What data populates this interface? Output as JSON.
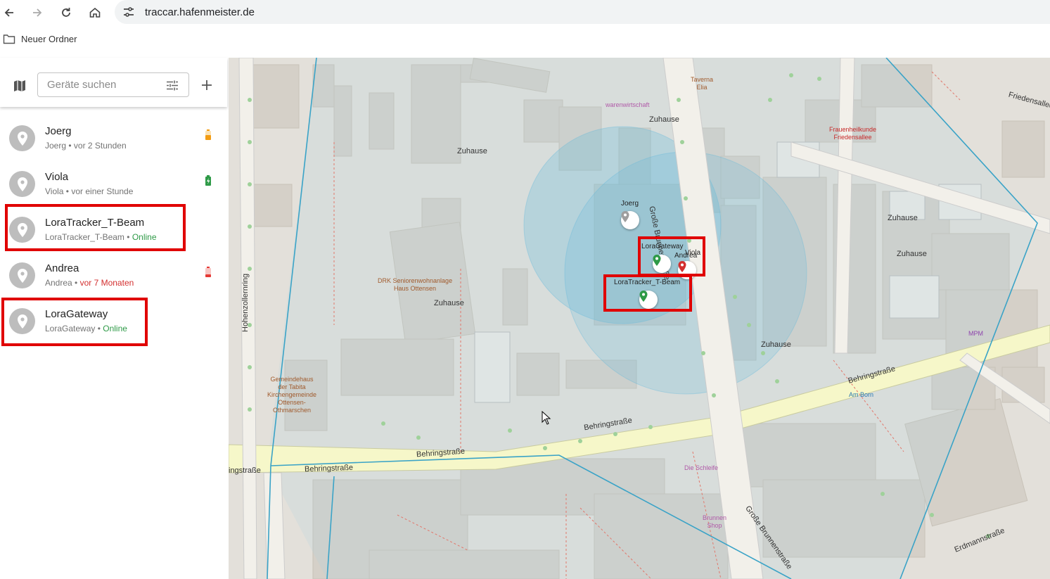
{
  "browser": {
    "url": "traccar.hafenmeister.de",
    "bookmark_folder": "Neuer Ordner"
  },
  "sidebar": {
    "search_placeholder": "Geräte suchen",
    "devices": [
      {
        "name": "Joerg",
        "sub_name": "Joerg",
        "sep": " • ",
        "status": "vor 2 Stunden",
        "status_type": "muted",
        "battery": "medium"
      },
      {
        "name": "Viola",
        "sub_name": "Viola",
        "sep": " • ",
        "status": "vor einer Stunde",
        "status_type": "muted",
        "battery": "charging"
      },
      {
        "name": "LoraTracker_T-Beam",
        "sub_name": "LoraTracker_T-Beam",
        "sep": " • ",
        "status": "Online",
        "status_type": "online"
      },
      {
        "name": "Andrea",
        "sub_name": "Andrea",
        "sep": " • ",
        "status": "vor 7 Monaten",
        "status_type": "offline",
        "battery": "low"
      },
      {
        "name": "LoraGateway",
        "sub_name": "LoraGateway",
        "sep": " • ",
        "status": "Online",
        "status_type": "online"
      }
    ]
  },
  "map": {
    "markers": {
      "joerg": "Joerg",
      "loragateway": "LoraGateway",
      "andrea": "Andrea",
      "viola": "Viola",
      "loratracker": "LoraTracker_T-Beam"
    },
    "labels": {
      "zuhause": "Zuhause",
      "drk": "DRK Seniorenwohnanlage\nHaus Ottensen",
      "gemeindehaus": "Gemeindehaus\nder Tabita\nKirchengemeinde\nOttensen-\nOthmarschen",
      "warenwirtschaft": "warenwirtschaft",
      "taverna": "Taverna\nElia",
      "frauenheilkunde": "Frauenheilkunde\nFriedensallee",
      "mpm": "MPM",
      "am_born": "Am Born",
      "die_schleife": "Die Schleife",
      "brunnen_shop": "Brunnen\nShop"
    },
    "streets": {
      "behringstrasse": "Behringstraße",
      "grosse_brunnenstrasse": "Große Brunnenstraße",
      "hohenzollernring": "Hohenzollernring",
      "friedensallee": "Friedensallee",
      "erdmannstrasse": "Erdmannstraße",
      "ringstrasse": "ingstraße"
    },
    "colors": {
      "highlight": "#e00000",
      "online": "#2e9a47",
      "offline": "#d32f2f",
      "accuracy_circle": "#4fb3d9"
    }
  }
}
